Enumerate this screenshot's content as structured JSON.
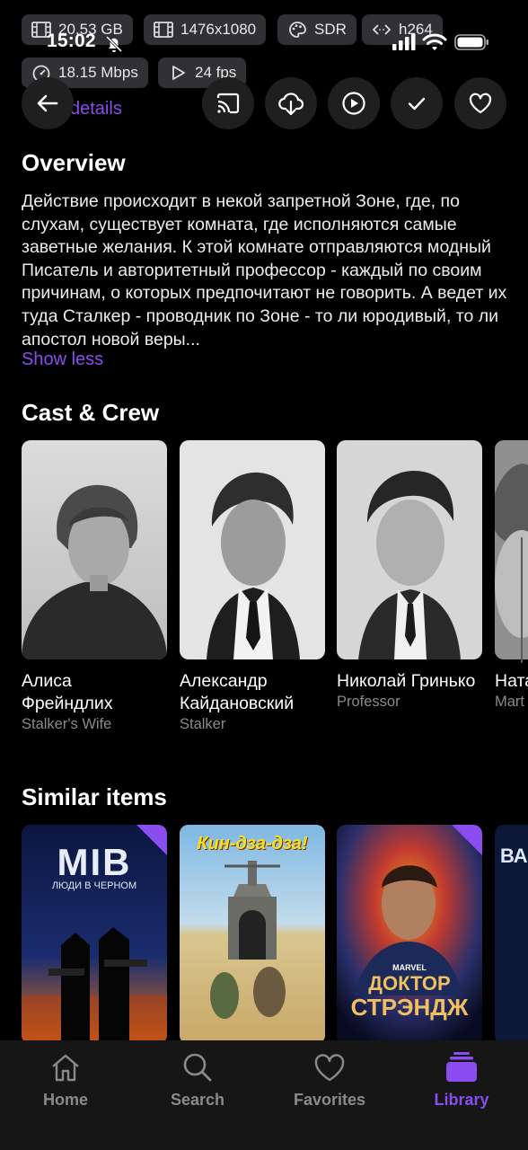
{
  "status_bar": {
    "time": "15:02",
    "chips": {
      "size": "20.53 GB",
      "resolution": "1476x1080",
      "range": "SDR",
      "codec": "h264",
      "bitrate": "18.15 Mbps",
      "fps": "24 fps"
    }
  },
  "header": {
    "details_link": "details"
  },
  "overview": {
    "title": "Overview",
    "text": "Действие происходит в некой запретной Зоне, где, по слухам, существует комната, где исполняются самые заветные желания. К этой комнате отправляются модный Писатель и авторитетный профессор - каждый по своим причинам, о которых предпочитают не говорить. А ведет их туда Сталкер - проводник по Зоне - то ли юродивый, то ли апостол новой веры...",
    "show_less": "Show less"
  },
  "cast": {
    "title": "Cast & Crew",
    "members": [
      {
        "name": "Алиса Фрейндлих",
        "role": "Stalker's Wife"
      },
      {
        "name": "Александр Кайдановский",
        "role": "Stalker"
      },
      {
        "name": "Николай Гринько",
        "role": "Professor"
      },
      {
        "name": "Ната Абр",
        "role": "Mart"
      }
    ]
  },
  "similar": {
    "title": "Similar items",
    "posters": [
      {
        "title_line1": "MIB",
        "title_line2": "ЛЮДИ В ЧЕРНОМ"
      },
      {
        "title_line1": "Кин-дза-дза!"
      },
      {
        "title_line1": "MARVEL",
        "title_line2": "ДОКТОР",
        "title_line3": "СТРЭНДЖ"
      },
      {
        "title_line1": "ВА"
      }
    ]
  },
  "nav": {
    "items": [
      {
        "label": "Home",
        "icon": "home-icon"
      },
      {
        "label": "Search",
        "icon": "search-icon"
      },
      {
        "label": "Favorites",
        "icon": "heart-icon"
      },
      {
        "label": "Library",
        "icon": "library-icon"
      }
    ],
    "active": "Library"
  },
  "colors": {
    "accent": "#8b4cf0",
    "background": "#000000",
    "nav_bg": "#161616"
  }
}
